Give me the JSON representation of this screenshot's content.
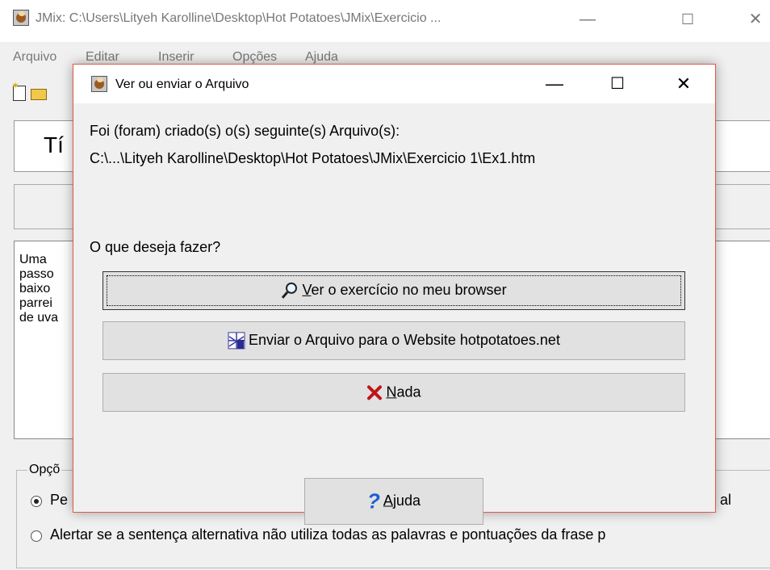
{
  "main_window": {
    "title": "JMix: C:\\Users\\Lityeh Karolline\\Desktop\\Hot Potatoes\\JMix\\Exercicio ...",
    "minimize": "—",
    "maximize": "☐",
    "close": "✕",
    "menu": [
      "Arquivo",
      "Editar",
      "Inserir",
      "Opções",
      "Ajuda"
    ],
    "title_field_text": "Tí",
    "textarea_lines": "Uma\npasso\nbaixo\nparrei\nde uva",
    "options_group_label": "Opçõ",
    "option1_start": "Pe",
    "option1_end": "al",
    "option2_text": "Alertar se a sentença alternativa não utiliza todas as palavras e pontuações da frase p",
    "scroll_up": "^",
    "scroll_down": "v"
  },
  "dialog": {
    "title": "Ver ou enviar o Arquivo",
    "minimize": "—",
    "maximize": "☐",
    "close": "✕",
    "created_label": "Foi (foram) criado(s) o(s) seguinte(s) Arquivo(s):",
    "file_path": "C:\\...\\Lityeh Karolline\\Desktop\\Hot Potatoes\\JMix\\Exercicio 1\\Ex1.htm",
    "question": "O que deseja fazer?",
    "btn_view_key": "V",
    "btn_view_rest": "er o exercício no meu browser",
    "btn_upload": "Enviar o Arquivo para o Website hotpotatoes.net",
    "btn_nothing_key": "N",
    "btn_nothing_rest": "ada",
    "btn_help_key": "A",
    "btn_help_rest": "juda",
    "icons": {
      "view": "magnifier-icon",
      "upload": "upload-web-icon",
      "nothing": "red-x-icon",
      "help": "question-mark-icon"
    }
  }
}
